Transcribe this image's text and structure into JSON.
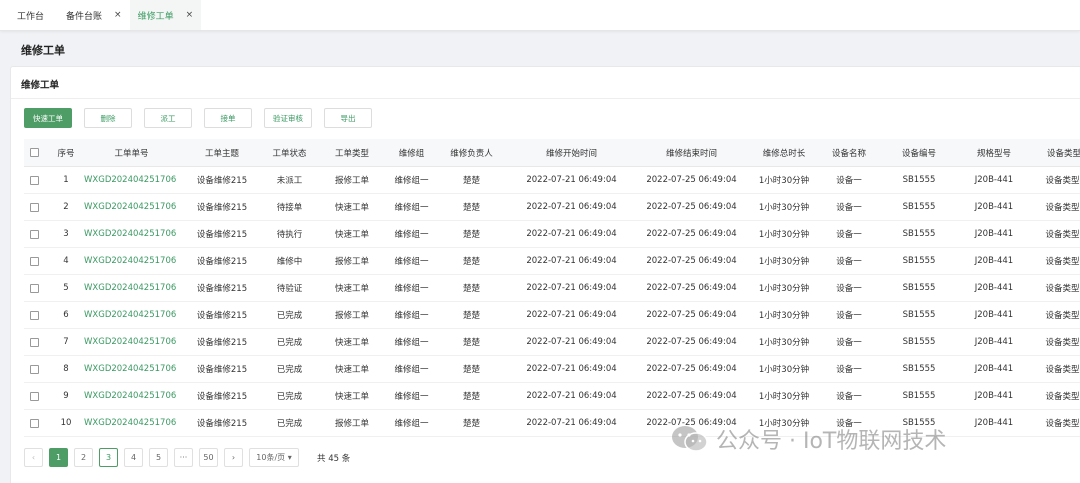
{
  "tabs": [
    {
      "label": "工作台",
      "closable": false,
      "active": false
    },
    {
      "label": "备件台账",
      "closable": true,
      "active": false
    },
    {
      "label": "维修工单",
      "closable": true,
      "active": true
    }
  ],
  "close_glyph": "×",
  "page_title": "维修工单",
  "card_title": "维修工单",
  "toolbar": [
    "快速工单",
    "删除",
    "派工",
    "接单",
    "验证审核",
    "导出"
  ],
  "table": {
    "columns": [
      "序号",
      "工单单号",
      "工单主题",
      "工单状态",
      "工单类型",
      "维修组",
      "维修负责人",
      "维修开始时间",
      "维修结束时间",
      "维修总时长",
      "设备名称",
      "设备编号",
      "规格型号",
      "设备类型"
    ],
    "rows": [
      [
        "1",
        "WXGD202404251706",
        "设备维修215",
        "未派工",
        "报修工单",
        "维修组一",
        "楚楚",
        "2022-07-21 06:49:04",
        "2022-07-25 06:49:04",
        "1小时30分钟",
        "设备一",
        "SB1555",
        "J20B-441",
        "设备类型-"
      ],
      [
        "2",
        "WXGD202404251706",
        "设备维修215",
        "待接单",
        "快速工单",
        "维修组一",
        "楚楚",
        "2022-07-21 06:49:04",
        "2022-07-25 06:49:04",
        "1小时30分钟",
        "设备一",
        "SB1555",
        "J20B-441",
        "设备类型-"
      ],
      [
        "3",
        "WXGD202404251706",
        "设备维修215",
        "待执行",
        "快速工单",
        "维修组一",
        "楚楚",
        "2022-07-21 06:49:04",
        "2022-07-25 06:49:04",
        "1小时30分钟",
        "设备一",
        "SB1555",
        "J20B-441",
        "设备类型-"
      ],
      [
        "4",
        "WXGD202404251706",
        "设备维修215",
        "维修中",
        "报修工单",
        "维修组一",
        "楚楚",
        "2022-07-21 06:49:04",
        "2022-07-25 06:49:04",
        "1小时30分钟",
        "设备一",
        "SB1555",
        "J20B-441",
        "设备类型-"
      ],
      [
        "5",
        "WXGD202404251706",
        "设备维修215",
        "待验证",
        "快速工单",
        "维修组一",
        "楚楚",
        "2022-07-21 06:49:04",
        "2022-07-25 06:49:04",
        "1小时30分钟",
        "设备一",
        "SB1555",
        "J20B-441",
        "设备类型-"
      ],
      [
        "6",
        "WXGD202404251706",
        "设备维修215",
        "已完成",
        "报修工单",
        "维修组一",
        "楚楚",
        "2022-07-21 06:49:04",
        "2022-07-25 06:49:04",
        "1小时30分钟",
        "设备一",
        "SB1555",
        "J20B-441",
        "设备类型-"
      ],
      [
        "7",
        "WXGD202404251706",
        "设备维修215",
        "已完成",
        "快速工单",
        "维修组一",
        "楚楚",
        "2022-07-21 06:49:04",
        "2022-07-25 06:49:04",
        "1小时30分钟",
        "设备一",
        "SB1555",
        "J20B-441",
        "设备类型-"
      ],
      [
        "8",
        "WXGD202404251706",
        "设备维修215",
        "已完成",
        "快速工单",
        "维修组一",
        "楚楚",
        "2022-07-21 06:49:04",
        "2022-07-25 06:49:04",
        "1小时30分钟",
        "设备一",
        "SB1555",
        "J20B-441",
        "设备类型-"
      ],
      [
        "9",
        "WXGD202404251706",
        "设备维修215",
        "已完成",
        "快速工单",
        "维修组一",
        "楚楚",
        "2022-07-21 06:49:04",
        "2022-07-25 06:49:04",
        "1小时30分钟",
        "设备一",
        "SB1555",
        "J20B-441",
        "设备类型-"
      ],
      [
        "10",
        "WXGD202404251706",
        "设备维修215",
        "已完成",
        "报修工单",
        "维修组一",
        "楚楚",
        "2022-07-21 06:49:04",
        "2022-07-25 06:49:04",
        "1小时30分钟",
        "设备一",
        "SB1555",
        "J20B-441",
        "设备类型-"
      ]
    ]
  },
  "pagination": {
    "prev": "‹",
    "next": "›",
    "pages": [
      "1",
      "2",
      "3",
      "4",
      "5",
      "···",
      "50"
    ],
    "current": "1",
    "page_size": "10条/页 ▾",
    "total": "共 45 条"
  },
  "watermark": "公众号 · IoT物联网技术",
  "colors": {
    "accent": "#4e9d66",
    "link": "#3a9a62"
  }
}
